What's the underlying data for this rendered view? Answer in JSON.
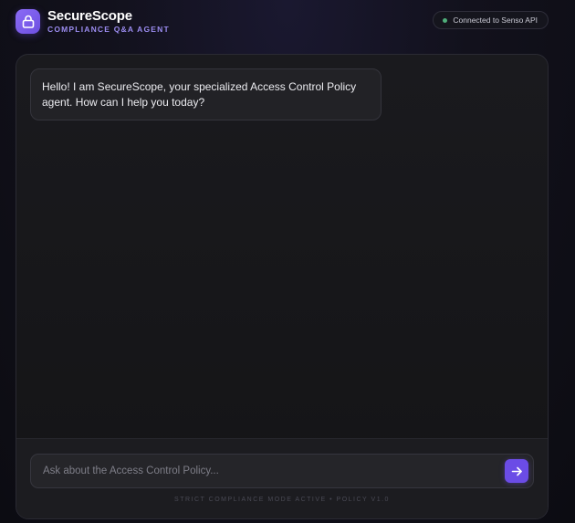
{
  "header": {
    "logo_icon": "lock-icon",
    "title": "SecureScope",
    "subtitle": "COMPLIANCE Q&A AGENT",
    "status": {
      "text": "Connected to Senso API",
      "color": "#4fae7a"
    }
  },
  "chat": {
    "messages": [
      {
        "role": "agent",
        "text": "Hello! I am SecureScope, your specialized Access Control Policy agent. How can I help you today?"
      }
    ]
  },
  "composer": {
    "placeholder": "Ask about the Access Control Policy...",
    "value": "",
    "send_icon": "arrow-right-icon",
    "footer": "STRICT COMPLIANCE MODE ACTIVE • POLICY V1.0"
  },
  "colors": {
    "accent": "#6b4ce6",
    "accent_light": "#9b8cf0",
    "background": "#12111c",
    "panel": "#1a1a1e"
  }
}
